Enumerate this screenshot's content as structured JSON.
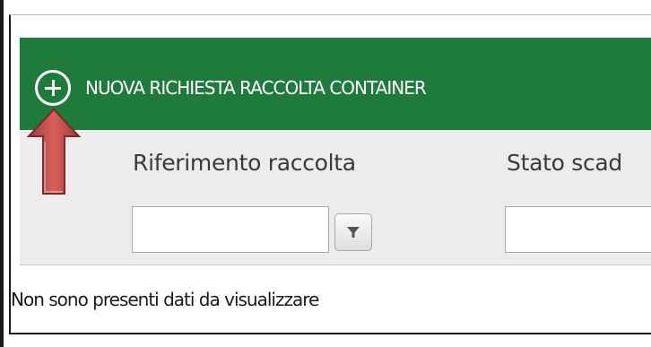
{
  "toolbar": {
    "add_label": "NUOVA RICHIESTA RACCOLTA CONTAINER",
    "add_icon": "plus-circle-icon",
    "background_color": "#1e7b3c"
  },
  "grid": {
    "columns": [
      {
        "label": "Riferimento raccolta"
      },
      {
        "label": "Stato scad"
      }
    ],
    "filters": [
      {
        "value": "",
        "filter_icon": "filter-funnel-icon"
      },
      {
        "value": ""
      }
    ],
    "empty_message": "Non sono presenti dati da visualizzare"
  },
  "annotation": {
    "arrow_icon": "red-up-arrow-icon",
    "arrow_color": "#c0504d"
  }
}
